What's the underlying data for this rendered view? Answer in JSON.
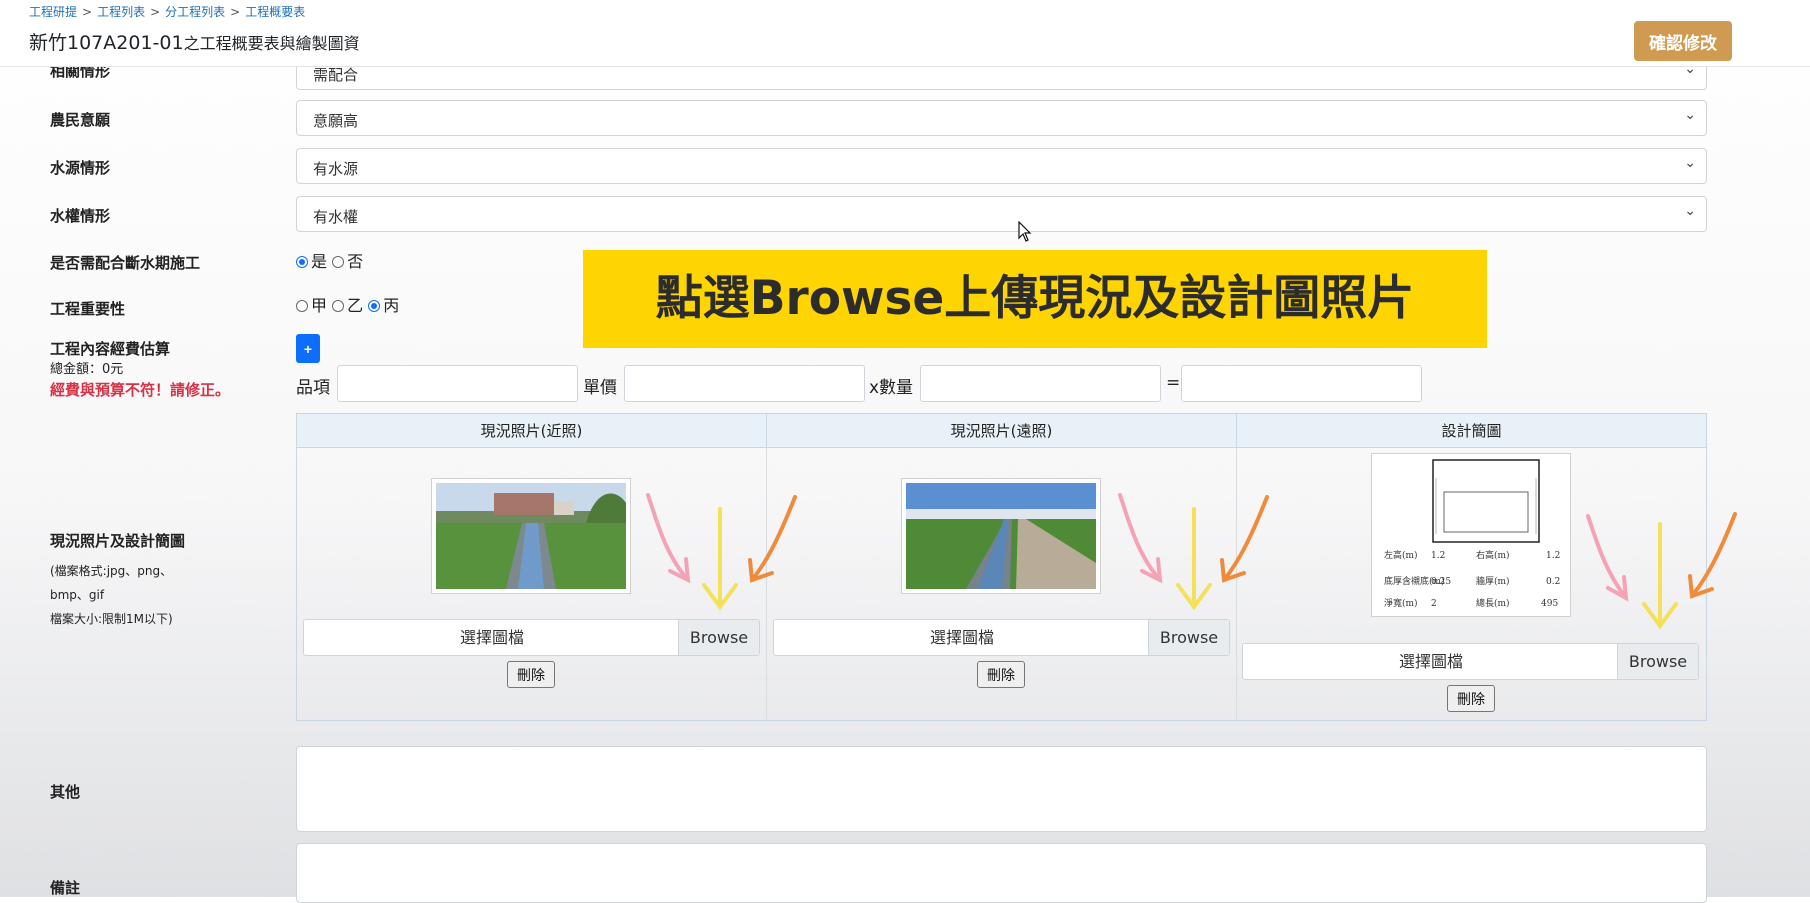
{
  "breadcrumb": {
    "items": [
      "工程研提",
      "工程列表",
      "分工程列表",
      "工程概要表"
    ],
    "separator": ">"
  },
  "title": {
    "main": "新竹107A201-01",
    "suffix": "之工程概要表與繪製圖資"
  },
  "actions": {
    "confirm_label": "確認修改"
  },
  "fields": {
    "cooperation": {
      "label": "相關情形",
      "value": "需配合"
    },
    "farmer_willingness": {
      "label": "農民意願",
      "value": "意願高"
    },
    "water_source": {
      "label": "水源情形",
      "value": "有水源"
    },
    "water_rights": {
      "label": "水權情形",
      "value": "有水權"
    },
    "water_cutoff": {
      "label": "是否需配合斷水期施工",
      "options": [
        "是",
        "否"
      ],
      "selected": "是"
    },
    "importance": {
      "label": "工程重要性",
      "options": [
        "甲",
        "乙",
        "丙"
      ],
      "selected": "丙"
    },
    "budget": {
      "label": "工程內容經費估算",
      "add_label": "+",
      "total": "總金額：0元",
      "warning": "經費與預算不符！請修正。",
      "item_label": "品項",
      "unit_price_label": "單價",
      "qty_label": "x數量",
      "equals": "="
    }
  },
  "banner": {
    "text": "點選Browse上傳現況及設計圖照片"
  },
  "photos": {
    "label": "現況照片及設計簡圖",
    "notes": [
      "(檔案格式:jpg、png、",
      "bmp、gif",
      "檔案大小:限制1M以下)"
    ],
    "columns": [
      {
        "header": "現況照片(近照)",
        "choose": "選擇圖檔",
        "browse": "Browse",
        "delete": "刪除"
      },
      {
        "header": "現況照片(遠照)",
        "choose": "選擇圖檔",
        "browse": "Browse",
        "delete": "刪除"
      },
      {
        "header": "設計簡圖",
        "choose": "選擇圖檔",
        "browse": "Browse",
        "delete": "刪除"
      }
    ],
    "design_sketch": {
      "left_height_label": "左高(m)",
      "left_height": "1.2",
      "right_height_label": "右高(m)",
      "right_height": "1.2",
      "base_label": "底厚含襯底(m)",
      "base": "0.25",
      "wall_label": "牆厚(m)",
      "wall": "0.2",
      "width_label": "淨寬(m)",
      "width": "2",
      "length_label": "總長(m)",
      "length": "495"
    }
  },
  "other": {
    "label": "其他"
  },
  "remarks": {
    "label": "備註"
  },
  "colors": {
    "banner": "#fed401",
    "confirm": "#cf9a52",
    "primary": "#0d6efd",
    "warning": "#d63347"
  }
}
